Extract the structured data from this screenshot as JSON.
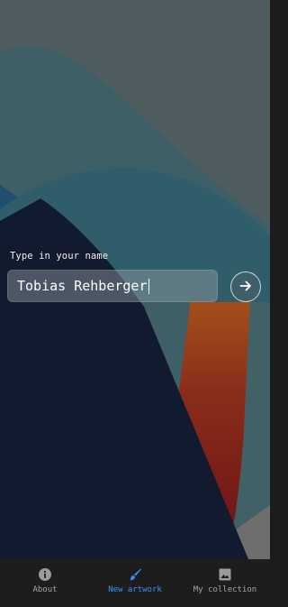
{
  "name_form": {
    "label": "Type in your name",
    "value": "Tobias Rehberger",
    "submit_icon": "arrow-right-icon"
  },
  "bottom_nav": {
    "items": [
      {
        "label": "About",
        "icon": "info-icon",
        "active": false
      },
      {
        "label": "New artwork",
        "icon": "brush-icon",
        "active": true
      },
      {
        "label": "My collection",
        "icon": "image-icon",
        "active": false
      }
    ]
  },
  "colors": {
    "accent": "#3d8ef5",
    "nav_background": "#1d1d1d",
    "artwork_background": "#4f5d5f",
    "artwork_navy": "#121a30",
    "artwork_teal": "#2f5d6a",
    "artwork_red": "#751516",
    "artwork_orange": "#a04a1a"
  }
}
